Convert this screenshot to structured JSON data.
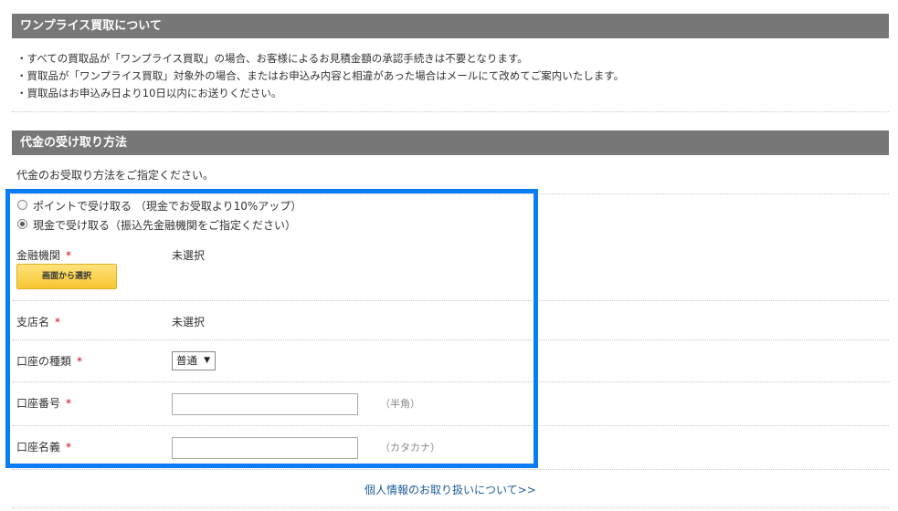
{
  "section1": {
    "title": "ワンプライス買取について",
    "bullets": [
      "・すべての買取品が「ワンプライス買取」の場合、お客様によるお見積金額の承認手続きは不要となります。",
      "・買取品が「ワンプライス買取」対象外の場合、またはお申込み内容と相違があった場合はメールにて改めてご案内いたします。",
      "・買取品はお申込み日より10日以内にお送りください。"
    ]
  },
  "section2": {
    "title": "代金の受け取り方法",
    "instruction": "代金のお受取り方法をご指定ください。",
    "options": [
      {
        "label": "ポイントで受け取る （現金でお受取より10%アップ）",
        "checked": false
      },
      {
        "label": "現金で受け取る（振込先金融機関をご指定ください）",
        "checked": true
      }
    ],
    "required_mark": "*",
    "fields": {
      "bank": {
        "label": "金融機関",
        "value": "未選択",
        "button": "画面から選択"
      },
      "branch": {
        "label": "支店名",
        "value": "未選択"
      },
      "account_type": {
        "label": "口座の種類",
        "selected": "普通"
      },
      "account_number": {
        "label": "口座番号",
        "value": "",
        "hint": "（半角）"
      },
      "account_name": {
        "label": "口座名義",
        "value": "",
        "hint": "（カタカナ）"
      }
    }
  },
  "privacy_link": "個人情報のお取り扱いについて>>",
  "colors": {
    "header_bar": "#777777",
    "highlight_border": "#0a7cf5",
    "required": "#d0021b",
    "button": "#f7c531"
  }
}
